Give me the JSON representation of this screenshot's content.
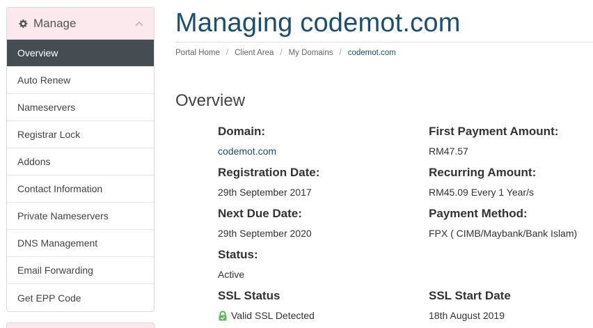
{
  "sidebar": {
    "title": "Manage",
    "items": [
      {
        "label": "Overview",
        "active": true
      },
      {
        "label": "Auto Renew"
      },
      {
        "label": "Nameservers"
      },
      {
        "label": "Registrar Lock"
      },
      {
        "label": "Addons"
      },
      {
        "label": "Contact Information"
      },
      {
        "label": "Private Nameservers"
      },
      {
        "label": "DNS Management"
      },
      {
        "label": "Email Forwarding"
      },
      {
        "label": "Get EPP Code"
      }
    ]
  },
  "header": {
    "title": "Managing codemot.com"
  },
  "breadcrumb": {
    "items": [
      "Portal Home",
      "Client Area",
      "My Domains"
    ],
    "current": "codemot.com"
  },
  "overview": {
    "title": "Overview",
    "domain_label": "Domain:",
    "domain_value": "codemot.com",
    "registration_date_label": "Registration Date:",
    "registration_date_value": "29th September 2017",
    "next_due_date_label": "Next Due Date:",
    "next_due_date_value": "29th September 2020",
    "status_label": "Status:",
    "status_value": "Active",
    "ssl_status_label": "SSL Status",
    "ssl_status_value": "Valid SSL Detected",
    "first_payment_label": "First Payment Amount:",
    "first_payment_value": "RM47.57",
    "recurring_amount_label": "Recurring Amount:",
    "recurring_amount_value": "RM45.09 Every 1 Year/s",
    "payment_method_label": "Payment Method:",
    "payment_method_value": "FPX ( CIMB/Maybank/Bank Islam)",
    "ssl_start_date_label": "SSL Start Date",
    "ssl_start_date_value": "18th August 2019"
  },
  "colors": {
    "brand": "#1b4f72",
    "sidebar_header_bg": "#fbe9ee",
    "sidebar_active_bg": "#454d53",
    "ssl_lock": "#5cb85c"
  },
  "icons": {
    "sidebar_header": "gear-icon",
    "sidebar_toggle": "chevron-up-icon",
    "ssl": "lock-icon"
  }
}
